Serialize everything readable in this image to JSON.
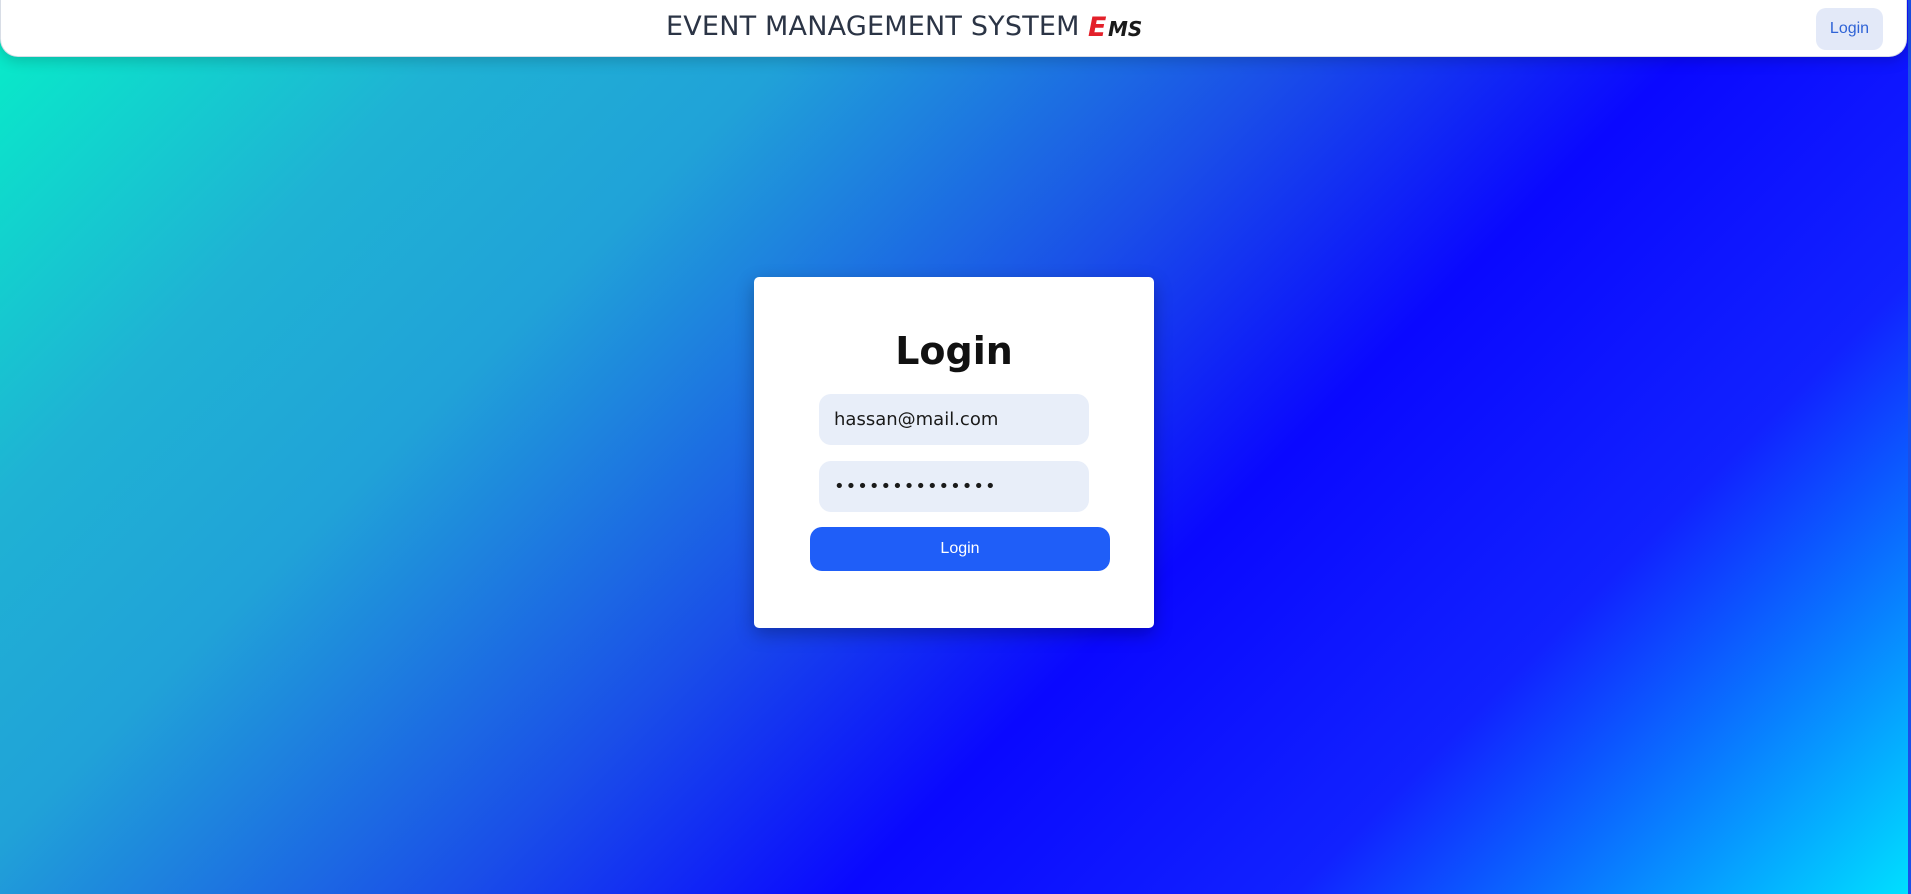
{
  "header": {
    "title": "EVENT MANAGEMENT SYSTEM",
    "logo_text": "EMS",
    "login_label": "Login"
  },
  "login_form": {
    "heading": "Login",
    "email_value": "hassan@mail.com",
    "password_value": "••••••••••••••",
    "submit_label": "Login"
  },
  "colors": {
    "logo_e": "#e3202a",
    "logo_ms": "#1a1a1a",
    "primary_button": "#1f5ef8",
    "input_background": "#e8eef9"
  },
  "icons": {
    "logo": "ems-logo-icon"
  }
}
